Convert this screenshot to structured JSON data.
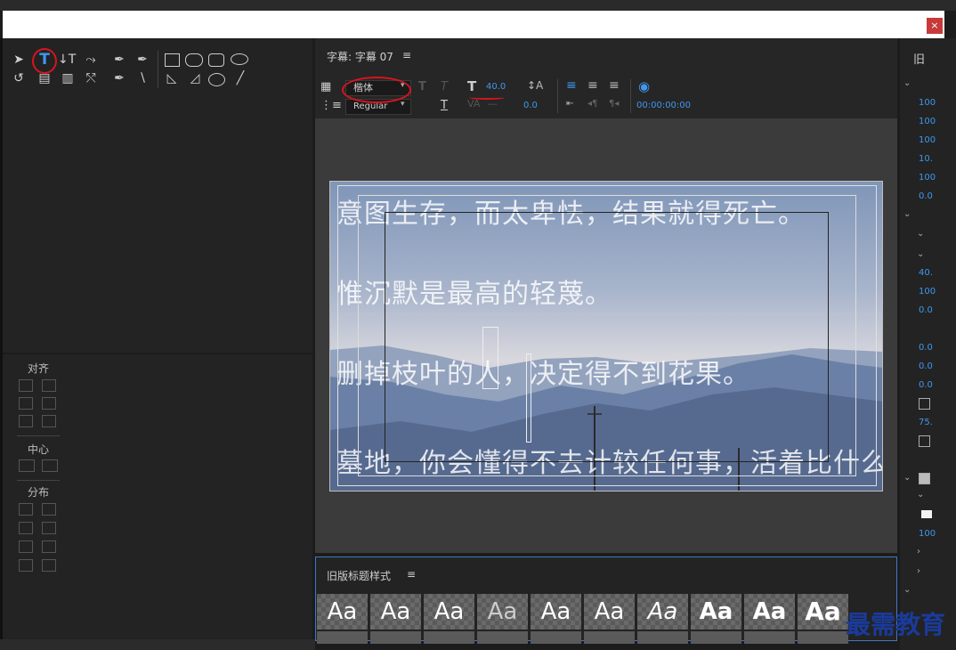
{
  "window": {
    "close_label": "×"
  },
  "title_panel": {
    "title": "字幕: 字幕 07",
    "menu": "≡"
  },
  "toolbar": {
    "font_family": "楷体",
    "font_style": "Regular",
    "font_size": "40.0",
    "leading": "0.0",
    "timecode": "00:00:00:00",
    "bold_T": "T",
    "italic_T": "T",
    "size_T": "T",
    "underline_T": "T"
  },
  "subtitles": [
    "意图生存，而太卑怯，结果就得死亡。",
    "惟沉默是最高的轻蔑。",
    "删掉枝叶的人，决定得不到花果。",
    "墓地，你会懂得不去计较任何事，活着比什么重要。"
  ],
  "actions": {
    "align": "对齐",
    "center": "中心",
    "distribute": "分布"
  },
  "styles_panel": {
    "title": "旧版标题样式",
    "menu": "≡",
    "swatches": [
      "Aa",
      "Aa",
      "Aa",
      "Aa",
      "Aa",
      "Aa",
      "Aa",
      "Aa",
      "Aa",
      "Aa"
    ]
  },
  "right_panel": {
    "title": "旧",
    "values": [
      "100",
      "100",
      "100",
      "10.",
      "100",
      "0.0",
      "40.",
      "100",
      "0.0",
      "0.0",
      "0.0",
      "0.0",
      "75.",
      "100"
    ]
  },
  "watermark": "最需教育"
}
